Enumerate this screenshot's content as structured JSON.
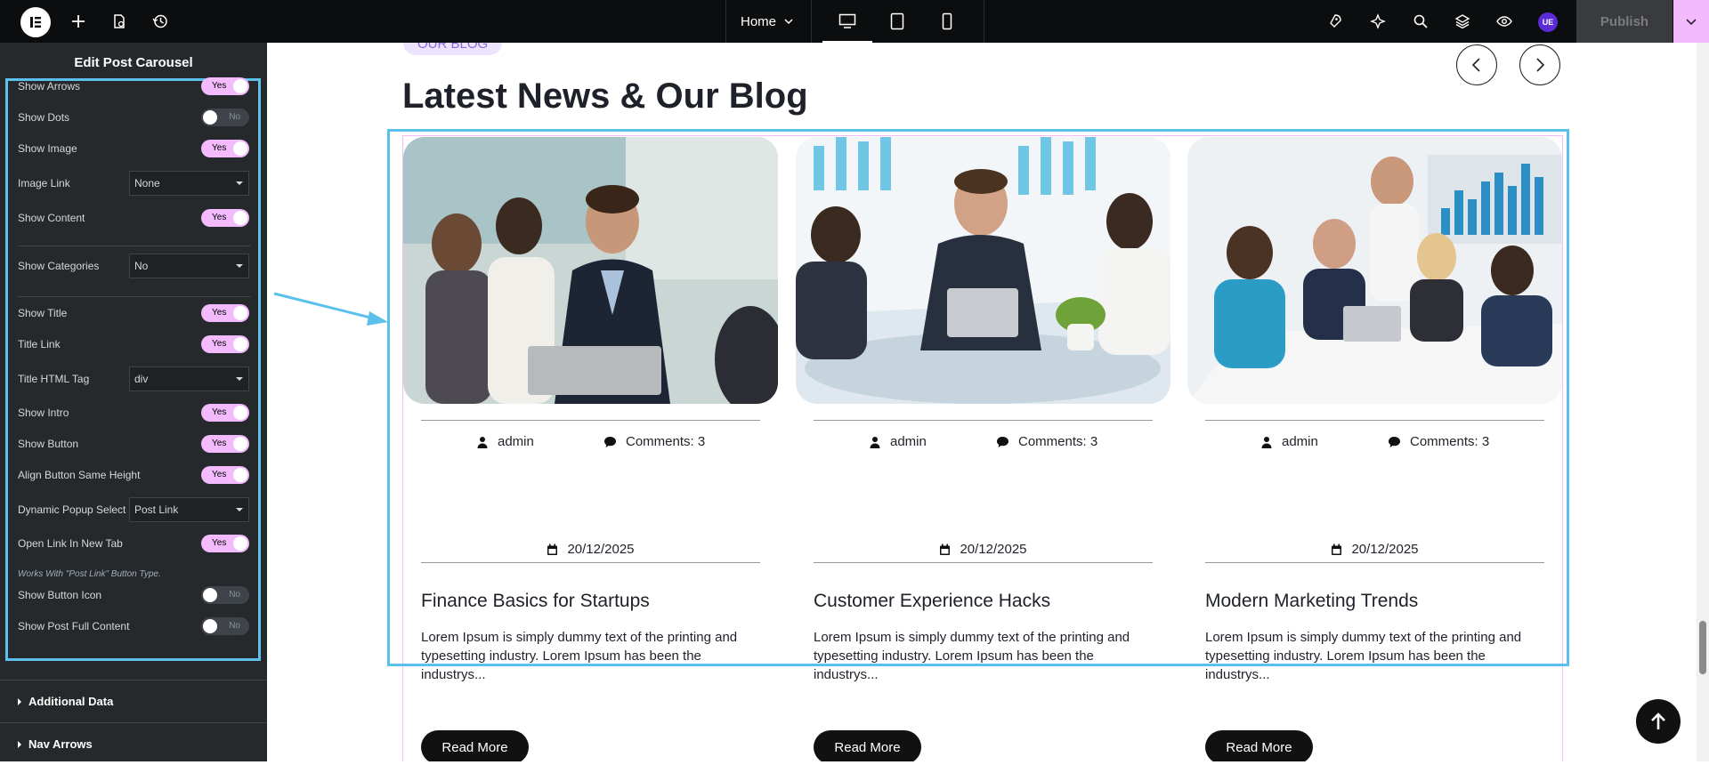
{
  "topbar": {
    "page_name": "Home",
    "avatar_initials": "UE",
    "publish_label": "Publish"
  },
  "panel": {
    "title": "Edit Post Carousel",
    "controls": [
      {
        "label": "Show Arrows",
        "type": "toggle",
        "value": "Yes"
      },
      {
        "label": "Show Dots",
        "type": "toggle",
        "value": "No"
      },
      {
        "label": "Show Image",
        "type": "toggle",
        "value": "Yes"
      },
      {
        "label": "Image Link",
        "type": "select",
        "value": "None"
      },
      {
        "label": "Show Content",
        "type": "toggle",
        "value": "Yes"
      },
      {
        "label": "Show Categories",
        "type": "select",
        "value": "No"
      },
      {
        "label": "Show Title",
        "type": "toggle",
        "value": "Yes"
      },
      {
        "label": "Title Link",
        "type": "toggle",
        "value": "Yes"
      },
      {
        "label": "Title HTML Tag",
        "type": "select",
        "value": "div"
      },
      {
        "label": "Show Intro",
        "type": "toggle",
        "value": "Yes"
      },
      {
        "label": "Show Button",
        "type": "toggle",
        "value": "Yes"
      },
      {
        "label": "Align Button Same Height",
        "type": "toggle",
        "value": "Yes"
      },
      {
        "label": "Dynamic Popup Select",
        "type": "select",
        "value": "Post Link"
      },
      {
        "label": "Open Link In New Tab",
        "type": "toggle",
        "value": "Yes"
      },
      {
        "label": "Show Button Icon",
        "type": "toggle",
        "value": "No"
      },
      {
        "label": "Show Post Full Content",
        "type": "toggle",
        "value": "No"
      }
    ],
    "note": "Works With \"Post Link\" Button Type.",
    "sections": [
      "Additional Data",
      "Nav Arrows"
    ]
  },
  "canvas": {
    "badge": "OUR BLOG",
    "heading": "Latest News & Our Blog",
    "cards": [
      {
        "author": "admin",
        "comments": "Comments: 3",
        "date": "20/12/2025",
        "title": "Finance Basics for Startups",
        "text": "Lorem Ipsum is simply dummy text of the printing and typesetting industry. Lorem Ipsum has been the industrys...",
        "button": "Read More"
      },
      {
        "author": "admin",
        "comments": "Comments: 3",
        "date": "20/12/2025",
        "title": "Customer Experience Hacks",
        "text": "Lorem Ipsum is simply dummy text of the printing and typesetting industry. Lorem Ipsum has been the industrys...",
        "button": "Read More"
      },
      {
        "author": "admin",
        "comments": "Comments: 3",
        "date": "20/12/2025",
        "title": "Modern Marketing Trends",
        "text": "Lorem Ipsum is simply dummy text of the printing and typesetting industry. Lorem Ipsum has been the industrys...",
        "button": "Read More"
      }
    ]
  },
  "colors": {
    "accent_pink": "#f3bafd",
    "highlight_blue": "#5bc0eb",
    "panel_bg": "#26292c",
    "topbar_bg": "#0c0d0e"
  }
}
